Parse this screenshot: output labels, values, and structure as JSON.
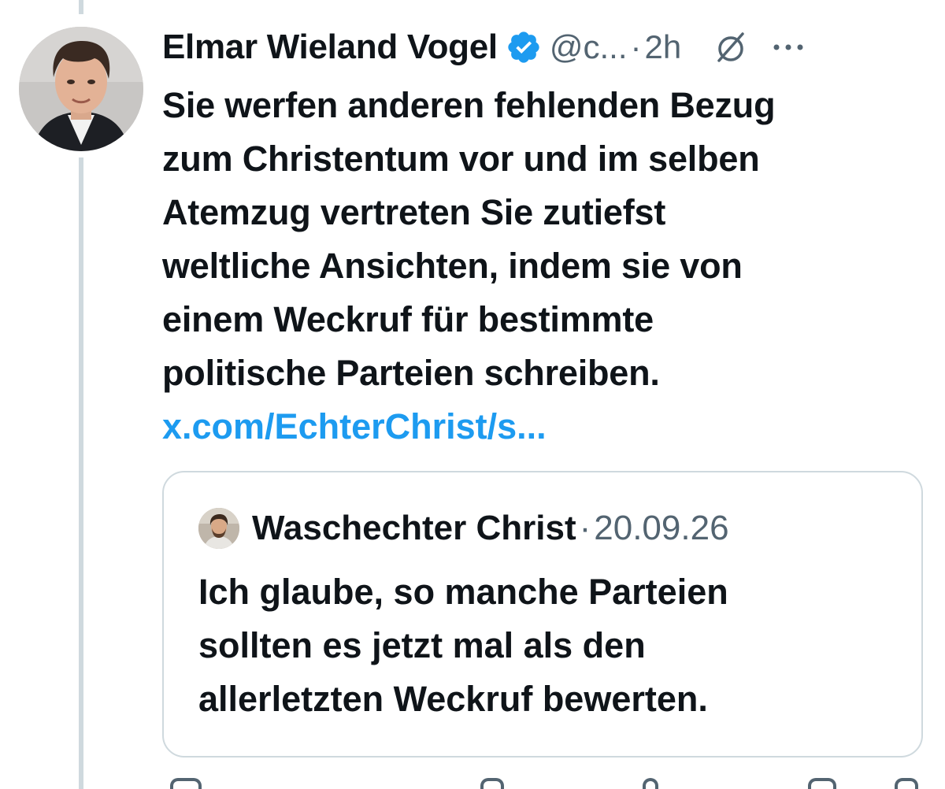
{
  "tweet": {
    "display_name": "Elmar Wieland Vogel",
    "handle": "@c...",
    "separator": "·",
    "time": "2h",
    "text_lines": [
      "Sie werfen anderen fehlenden Bezug",
      "zum Christentum vor und im selben",
      "Atemzug vertreten Sie zutiefst",
      "weltliche Ansichten, indem sie von",
      "einem Weckruf für bestimmte",
      "politische Parteien schreiben."
    ],
    "link": "x.com/EchterChrist/s..."
  },
  "quote": {
    "display_name": "Waschechter Christ",
    "separator": "·",
    "date": "20.09.26",
    "text_lines": [
      "Ich glaube, so manche Parteien",
      "sollten es jetzt mal als den",
      "allerletzten Weckruf bewerten."
    ]
  },
  "icons": {
    "verified": "verified-badge-icon",
    "grok": "grok-icon",
    "more": "more-icon",
    "reply": "reply-icon",
    "repost": "repost-icon",
    "like": "like-icon",
    "bookmark": "bookmark-icon",
    "share": "share-icon"
  },
  "colors": {
    "text": "#0f1419",
    "secondary": "#536471",
    "link": "#1d9bf0",
    "verified": "#1d9bf0",
    "border": "#cfd9de"
  }
}
